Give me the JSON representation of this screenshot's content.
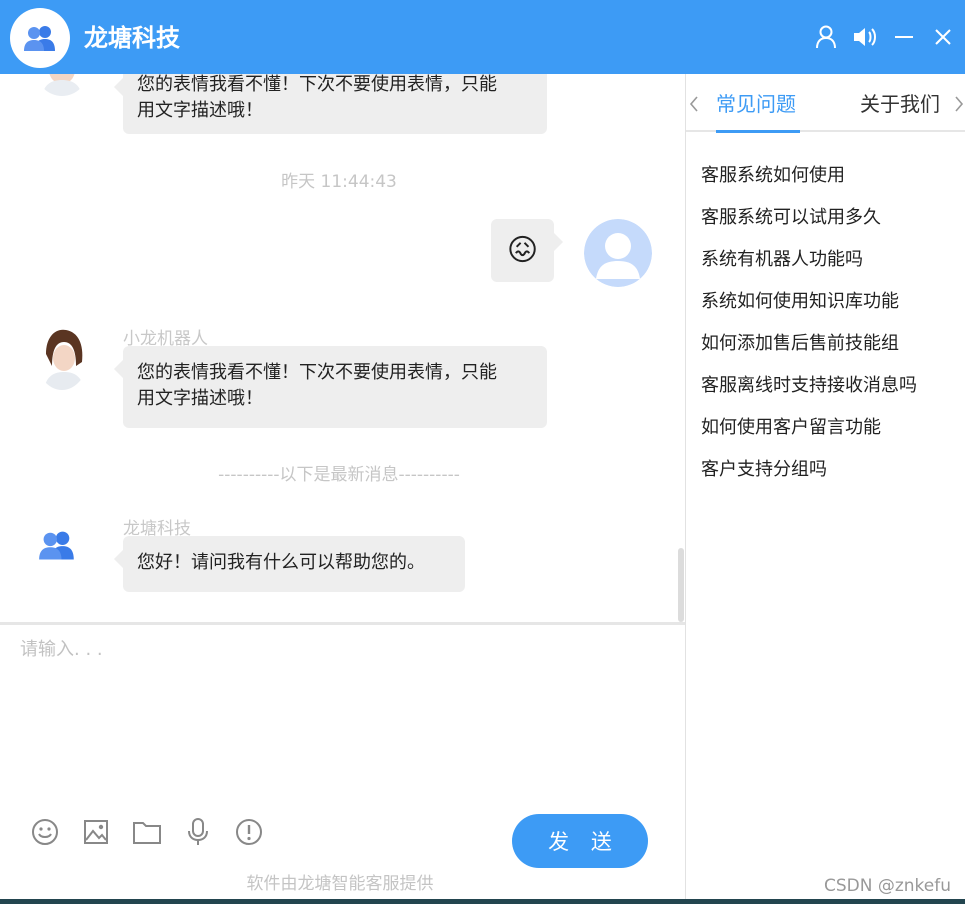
{
  "header": {
    "title": "龙塘科技",
    "accent_color": "#3d9bf5",
    "logo_icon": "users-group-icon",
    "buttons": [
      "user-icon",
      "volume-icon",
      "minimize-icon",
      "close-icon"
    ]
  },
  "chat": {
    "messages": [
      {
        "side": "left",
        "text_line1": "您的表情我看不懂！下次不要使用表情，只能",
        "text_line2": "用文字描述哦！"
      },
      {
        "timestamp": "昨天 11:44:43"
      },
      {
        "side": "right",
        "emoji": "😖"
      },
      {
        "side": "left",
        "sender": "小龙机器人",
        "text_line1": "您的表情我看不懂！下次不要使用表情，只能",
        "text_line2": "用文字描述哦！"
      },
      {
        "divider": "----------以下是最新消息----------"
      },
      {
        "side": "left",
        "sender": "龙塘科技",
        "text": "您好！请问我有什么可以帮助您的。"
      }
    ]
  },
  "input": {
    "placeholder": "请输入. . .",
    "send_label": "发 送",
    "tools": [
      "smiley-icon",
      "image-icon",
      "folder-icon",
      "microphone-icon",
      "alert-icon"
    ]
  },
  "footer": {
    "text": "软件由龙塘智能客服提供"
  },
  "side_panel": {
    "tabs": [
      {
        "label": "常见问题",
        "active": true
      },
      {
        "label": "关于我们",
        "active": false
      }
    ],
    "faq": [
      "客服系统如何使用",
      "客服系统可以试用多久",
      "系统有机器人功能吗",
      "系统如何使用知识库功能",
      "如何添加售后售前技能组",
      "客服离线时支持接收消息吗",
      "如何使用客户留言功能",
      "客户支持分组吗"
    ]
  },
  "watermark": "CSDN @znkefu"
}
